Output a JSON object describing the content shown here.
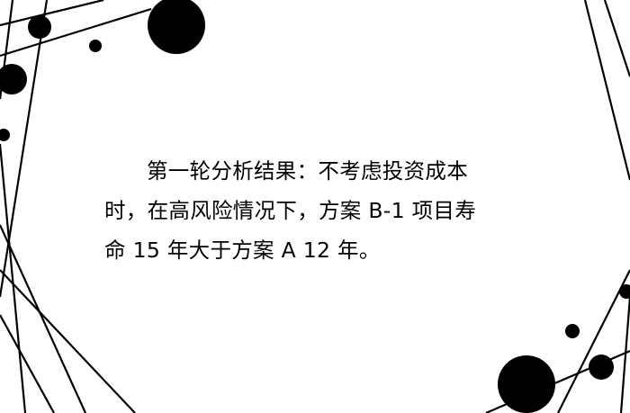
{
  "slide": {
    "lines": [
      "第一轮分析结果：不考虑投资成本",
      "时，在高风险情况下，方案 B-1 项目寿",
      "命 15 年大于方案 A 12 年。"
    ]
  },
  "colors": {
    "background": "#ffffff",
    "ink": "#000000"
  }
}
